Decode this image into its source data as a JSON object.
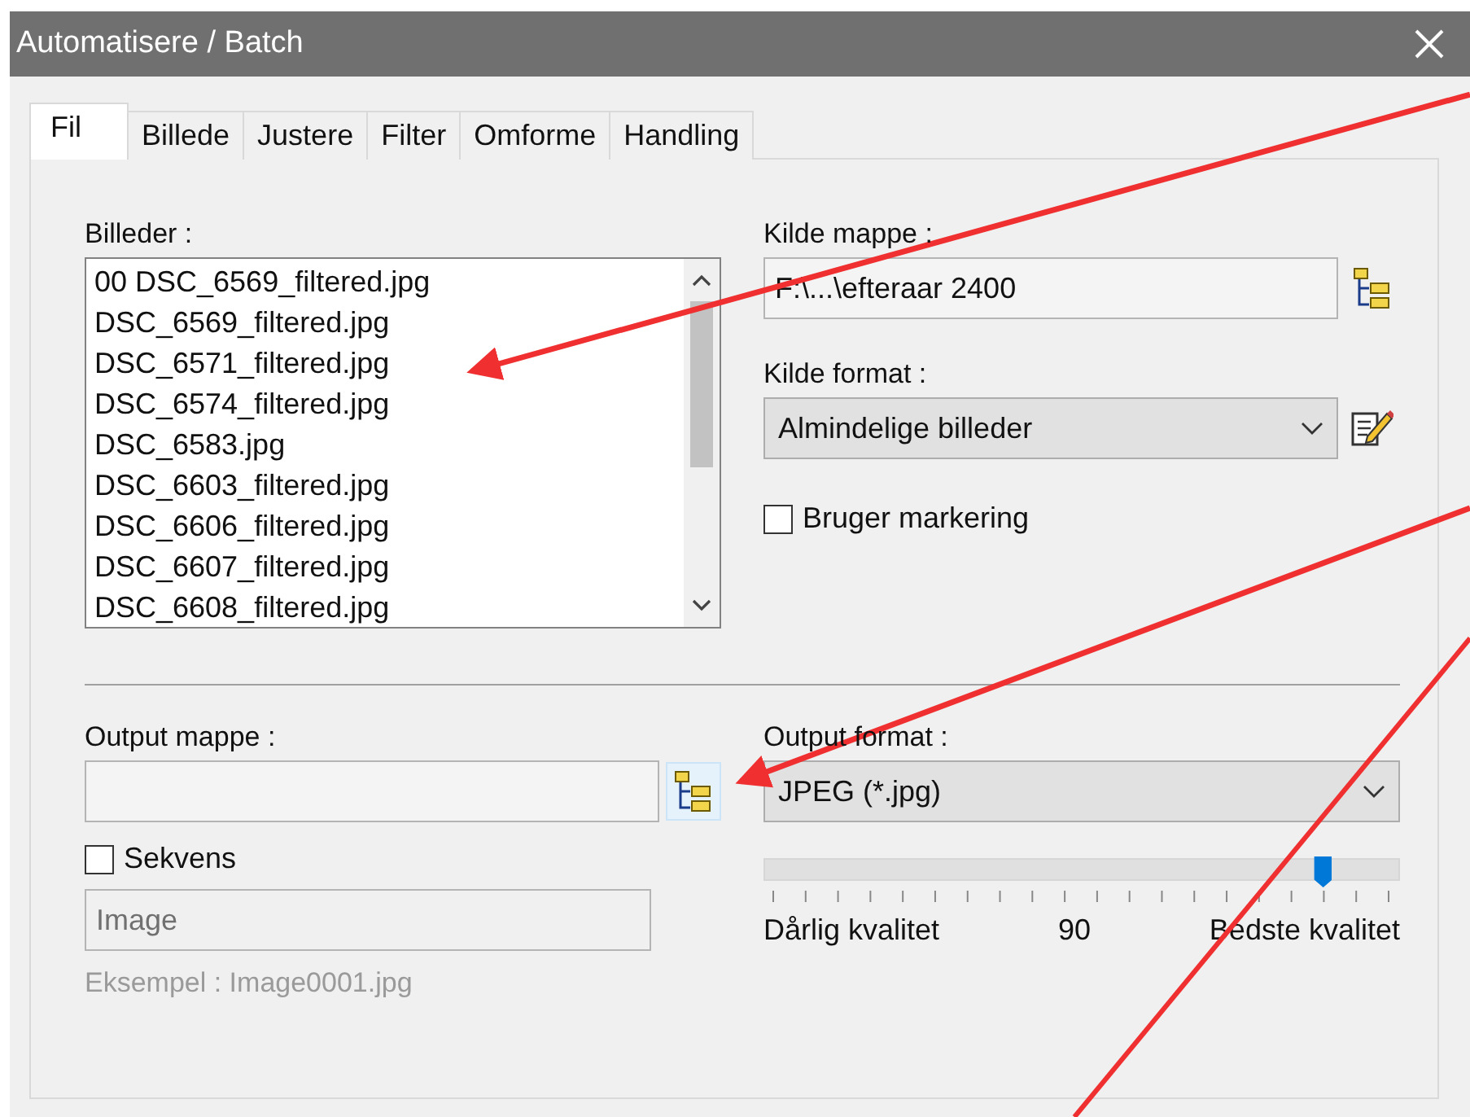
{
  "window": {
    "title": "Automatisere / Batch"
  },
  "tabs": [
    {
      "label": "Fil",
      "selected": true
    },
    {
      "label": "Billede",
      "selected": false
    },
    {
      "label": "Justere",
      "selected": false
    },
    {
      "label": "Filter",
      "selected": false
    },
    {
      "label": "Omforme",
      "selected": false
    },
    {
      "label": "Handling",
      "selected": false
    }
  ],
  "files": {
    "label": "Billeder :",
    "items": [
      "00 DSC_6569_filtered.jpg",
      "DSC_6569_filtered.jpg",
      "DSC_6571_filtered.jpg",
      "DSC_6574_filtered.jpg",
      "DSC_6583.jpg",
      "DSC_6603_filtered.jpg",
      "DSC_6606_filtered.jpg",
      "DSC_6607_filtered.jpg",
      "DSC_6608_filtered.jpg"
    ]
  },
  "source_folder": {
    "label": "Kilde mappe :",
    "value": "F:\\...\\efteraar 2400",
    "browse_highlighted": false
  },
  "source_format": {
    "label": "Kilde format :",
    "value": "Almindelige billeder"
  },
  "use_selection": {
    "label": "Bruger markering",
    "checked": false
  },
  "output_folder": {
    "label": "Output mappe :",
    "browse_highlighted": true
  },
  "sequence": {
    "label": "Sekvens",
    "checked": false
  },
  "name_field": {
    "value": "Image",
    "disabled": true
  },
  "example": {
    "text": "Eksempel : Image0001.jpg",
    "disabled": true
  },
  "output_format": {
    "label": "Output format :",
    "value": "JPEG (*.jpg)"
  },
  "quality": {
    "level": 0.88,
    "min_label": "Dårlig kvalitet",
    "value": "90",
    "max_label": "Bedste kvalitet"
  }
}
